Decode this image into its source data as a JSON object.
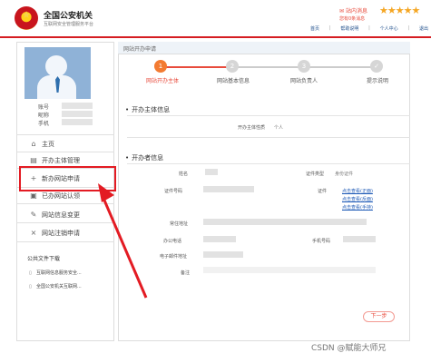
{
  "header": {
    "title": "全国公安机关",
    "subtitle": "互联网安全管理服务平台",
    "msg_label": "站内消息",
    "msg_count": "您有0条消息",
    "nav": [
      "首页",
      "帮助说明",
      "个人中心",
      "退出"
    ]
  },
  "content": {
    "breadcrumb": "网站开办申请",
    "steps": [
      "网站开办主体",
      "网站基本信息",
      "网站负责人",
      "提示说明"
    ],
    "sections": {
      "subject": "开办主体信息",
      "owner": "开办者信息"
    },
    "fields": {
      "subject_type": "开办主体性质",
      "subject_type_value": "个人",
      "name": "姓名",
      "id_type": "证件类型",
      "id_type_value": "身份证件",
      "id_number": "证件号码",
      "id_scan": "证件",
      "link1": "点击查看(正面)",
      "link2": "点击查看(反面)",
      "link3": "点击查看(手持)",
      "address": "常住地址",
      "office_phone": "办公电话",
      "mobile": "手机号码",
      "email": "电子邮件地址",
      "remark": "备注"
    },
    "next": "下一步"
  },
  "sidebar": {
    "profile": [
      "账号",
      "昵称",
      "手机"
    ],
    "menu": [
      "主页",
      "开办主体管理",
      "新办网站申请",
      "已办网站认领",
      "网站信息变更",
      "网站注销申请"
    ],
    "downloads_title": "公共文件下载",
    "downloads": [
      "互联网信息服务安全...",
      "全国公安机关互联网..."
    ]
  },
  "watermark": "CSDN @赋能大师兄"
}
